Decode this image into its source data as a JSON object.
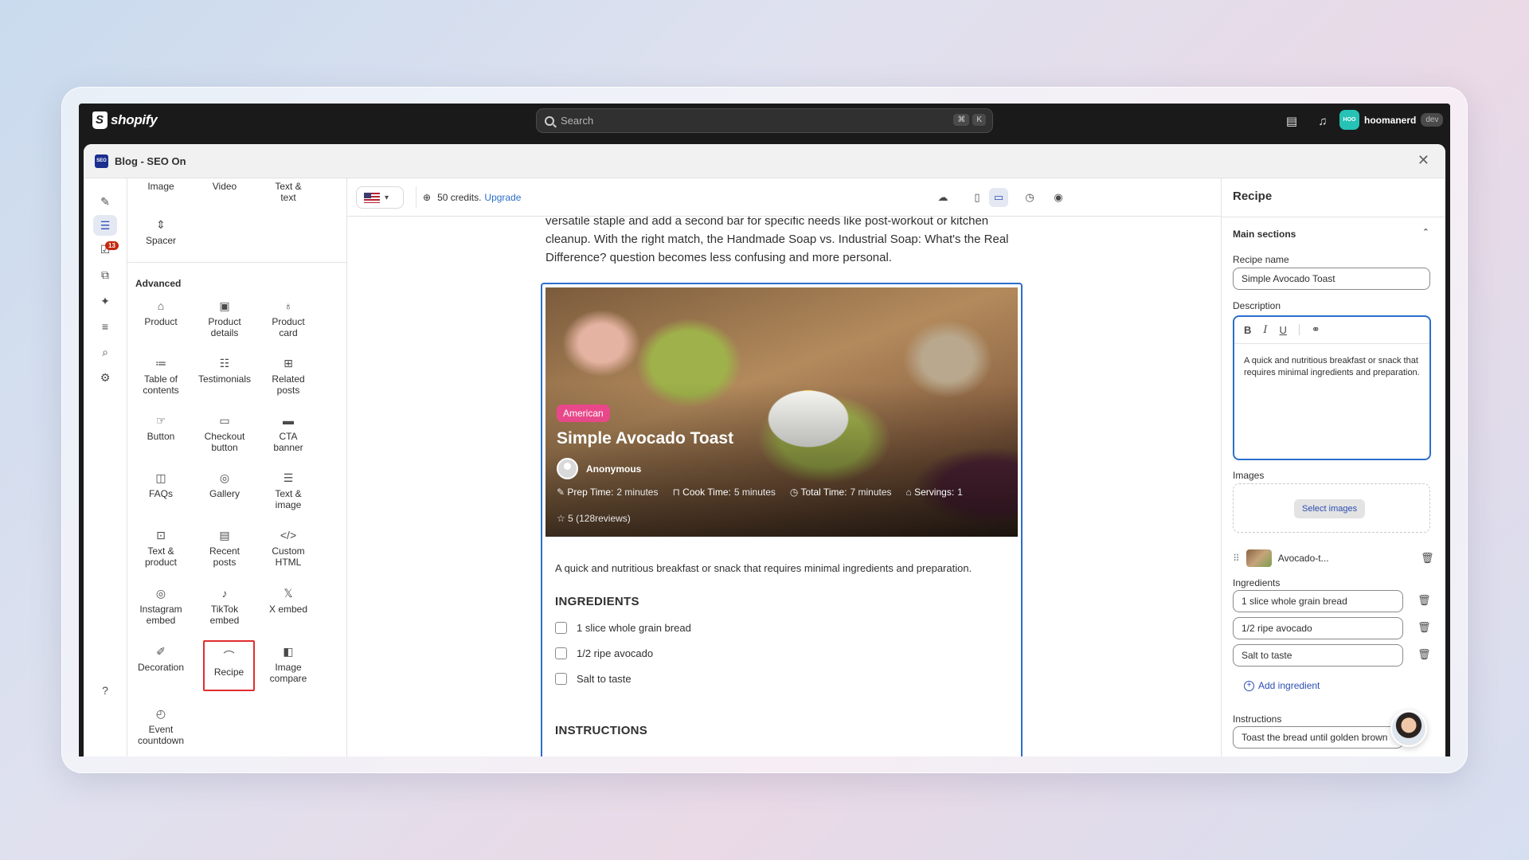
{
  "topbar": {
    "brand": "shopify",
    "search_placeholder": "Search",
    "shortcut_keys": [
      "⌘",
      "K"
    ],
    "user_initials": "HOO",
    "user_name": "hoomanerd",
    "user_tag": "dev"
  },
  "app": {
    "title": "Blog - SEO On",
    "rail_badge": "13"
  },
  "palette": {
    "top_items": [
      "Image",
      "Video",
      "Text &\ntext"
    ],
    "spacer_label": "Spacer",
    "advanced_heading": "Advanced",
    "items": [
      "Product",
      "Product\ndetails",
      "Product\ncard",
      "Table of\ncontents",
      "Testimonials",
      "Related\nposts",
      "Button",
      "Checkout\nbutton",
      "CTA\nbanner",
      "FAQs",
      "Gallery",
      "Text &\nimage",
      "Text &\nproduct",
      "Recent\nposts",
      "Custom\nHTML",
      "Instagram\nembed",
      "TikTok\nembed",
      "X embed",
      "Decoration",
      "Recipe",
      "Image\ncompare",
      "Event\ncountdown"
    ],
    "selected": "Recipe"
  },
  "canvasbar": {
    "credits_text": "50 credits.",
    "upgrade_link": "Upgrade"
  },
  "canvas": {
    "intro_text": "versatile staple and add a second bar for specific needs like post-workout or kitchen cleanup. With the right match, the Handmade Soap vs. Industrial Soap: What's the Real Difference? question becomes less confusing and more personal.",
    "recipe": {
      "cuisine_tag": "American",
      "title": "Simple Avocado Toast",
      "author": "Anonymous",
      "prep_label": "Prep Time:",
      "prep_value": "2 minutes",
      "cook_label": "Cook Time:",
      "cook_value": "5 minutes",
      "total_label": "Total Time:",
      "total_value": "7 minutes",
      "servings_label": "Servings:",
      "servings_value": "1",
      "rating_text": "5 (128reviews)",
      "description": "A quick and nutritious breakfast or snack that requires minimal ingredients and preparation.",
      "ingredients_heading": "INGREDIENTS",
      "ingredients": [
        "1 slice whole grain bread",
        "1/2 ripe avocado",
        "Salt to taste"
      ],
      "instructions_heading": "INSTRUCTIONS"
    }
  },
  "panel": {
    "title": "Recipe",
    "section_title": "Main sections",
    "recipe_name_label": "Recipe name",
    "recipe_name_value": "Simple Avocado Toast",
    "description_label": "Description",
    "description_value": "A quick and nutritious breakfast or snack that requires minimal ingredients and preparation.",
    "images_label": "Images",
    "select_images_button": "Select images",
    "image_file_name": "Avocado-t...",
    "ingredients_label": "Ingredients",
    "ingredients": [
      "1 slice whole grain bread",
      "1/2 ripe avocado",
      "Salt to taste"
    ],
    "add_ingredient": "Add ingredient",
    "instructions_label": "Instructions",
    "instructions_first": "Toast the bread until golden brown"
  }
}
